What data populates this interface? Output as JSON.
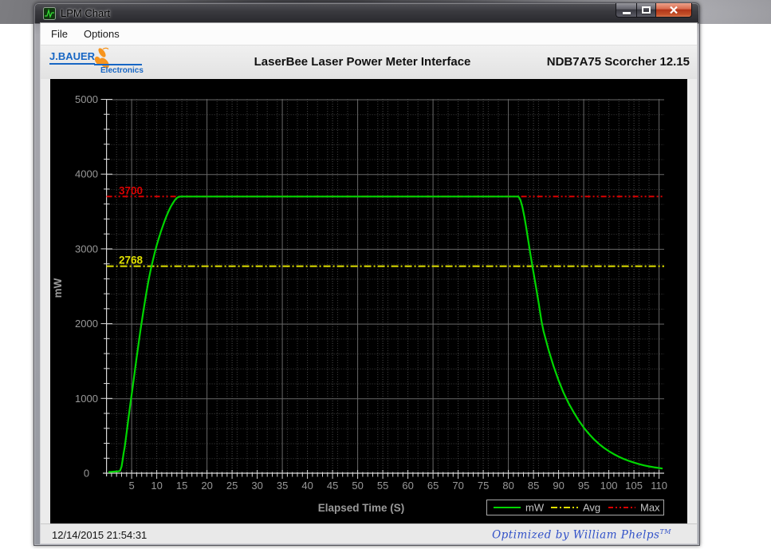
{
  "window": {
    "title": "LPM Chart"
  },
  "menu": {
    "items": [
      "File",
      "Options"
    ]
  },
  "header": {
    "logo_line1": "J.BAUER",
    "logo_line2": "Electronics",
    "title": "LaserBee Laser Power Meter Interface",
    "version": "NDB7A75 Scorcher 12.15"
  },
  "statusbar": {
    "datetime": "12/14/2015 21:54:31",
    "credit": "Optimized by William Phelps",
    "credit_tm": "TM"
  },
  "icons": {
    "app": "line-chart",
    "minimize": "minimize",
    "maximize": "maximize",
    "close": "close",
    "logo": "bee"
  },
  "chart_data": {
    "type": "line",
    "xlabel": "Elapsed Time (S)",
    "ylabel": "mW",
    "xlim": [
      0,
      111
    ],
    "ylim": [
      0,
      5000
    ],
    "x_ticks": [
      5,
      10,
      15,
      20,
      25,
      30,
      35,
      40,
      45,
      50,
      55,
      60,
      65,
      70,
      75,
      80,
      85,
      90,
      95,
      100,
      105,
      110
    ],
    "y_ticks": [
      0,
      1000,
      2000,
      3000,
      4000,
      5000
    ],
    "grid": {
      "minor_x_step": 2,
      "minor_y_step": 200,
      "major_y_step": 1000,
      "bright_x_lines": [
        5,
        20,
        35,
        50,
        65,
        80,
        95,
        110
      ]
    },
    "max_line": {
      "label": "3700",
      "value": 3700,
      "color": "#d80000"
    },
    "avg_line": {
      "label": "2768",
      "value": 2768,
      "color": "#e0e000"
    },
    "series": [
      {
        "name": "mW",
        "color": "#00d600",
        "points": [
          [
            0.4,
            15
          ],
          [
            1,
            18
          ],
          [
            1.8,
            22
          ],
          [
            2.4,
            26
          ],
          [
            2.7,
            32
          ],
          [
            3.0,
            90
          ],
          [
            3.2,
            175
          ],
          [
            3.4,
            265
          ],
          [
            3.6,
            340
          ],
          [
            4.0,
            540
          ],
          [
            4.4,
            750
          ],
          [
            4.8,
            950
          ],
          [
            5.2,
            1150
          ],
          [
            5.6,
            1350
          ],
          [
            6.0,
            1550
          ],
          [
            6.4,
            1740
          ],
          [
            6.8,
            1930
          ],
          [
            7.2,
            2110
          ],
          [
            7.6,
            2280
          ],
          [
            8.0,
            2440
          ],
          [
            8.4,
            2590
          ],
          [
            8.8,
            2720
          ],
          [
            9.2,
            2840
          ],
          [
            9.6,
            2950
          ],
          [
            10.0,
            3050
          ],
          [
            10.4,
            3140
          ],
          [
            10.8,
            3225
          ],
          [
            11.2,
            3305
          ],
          [
            11.6,
            3380
          ],
          [
            12.0,
            3448
          ],
          [
            12.4,
            3510
          ],
          [
            12.8,
            3565
          ],
          [
            13.2,
            3612
          ],
          [
            13.6,
            3652
          ],
          [
            14.0,
            3682
          ],
          [
            14.4,
            3696
          ],
          [
            14.8,
            3700
          ],
          [
            82,
            3700
          ],
          [
            82.4,
            3655
          ],
          [
            82.8,
            3560
          ],
          [
            83.2,
            3425
          ],
          [
            83.6,
            3265
          ],
          [
            84,
            3095
          ],
          [
            84.4,
            2925
          ],
          [
            84.8,
            2765
          ],
          [
            85.2,
            2605
          ],
          [
            85.6,
            2450
          ],
          [
            86,
            2290
          ],
          [
            86.6,
            2030
          ],
          [
            87,
            1900
          ],
          [
            88,
            1650
          ],
          [
            89,
            1430
          ],
          [
            90,
            1240
          ],
          [
            91,
            1075
          ],
          [
            92,
            935
          ],
          [
            93,
            815
          ],
          [
            94,
            705
          ],
          [
            95,
            610
          ],
          [
            96,
            528
          ],
          [
            97,
            456
          ],
          [
            98,
            394
          ],
          [
            99,
            340
          ],
          [
            100,
            295
          ],
          [
            101,
            255
          ],
          [
            102,
            220
          ],
          [
            103,
            190
          ],
          [
            104,
            164
          ],
          [
            105,
            142
          ],
          [
            106,
            122
          ],
          [
            107,
            105
          ],
          [
            108,
            91
          ],
          [
            109,
            79
          ],
          [
            110,
            69
          ],
          [
            110.7,
            62
          ]
        ]
      }
    ],
    "legend": [
      {
        "label": "mW",
        "color": "#00d600",
        "dash": "solid"
      },
      {
        "label": "Avg",
        "color": "#e0e000",
        "dash": "dashdot"
      },
      {
        "label": "Max",
        "color": "#d80000",
        "dash": "dashdotdot"
      }
    ]
  }
}
